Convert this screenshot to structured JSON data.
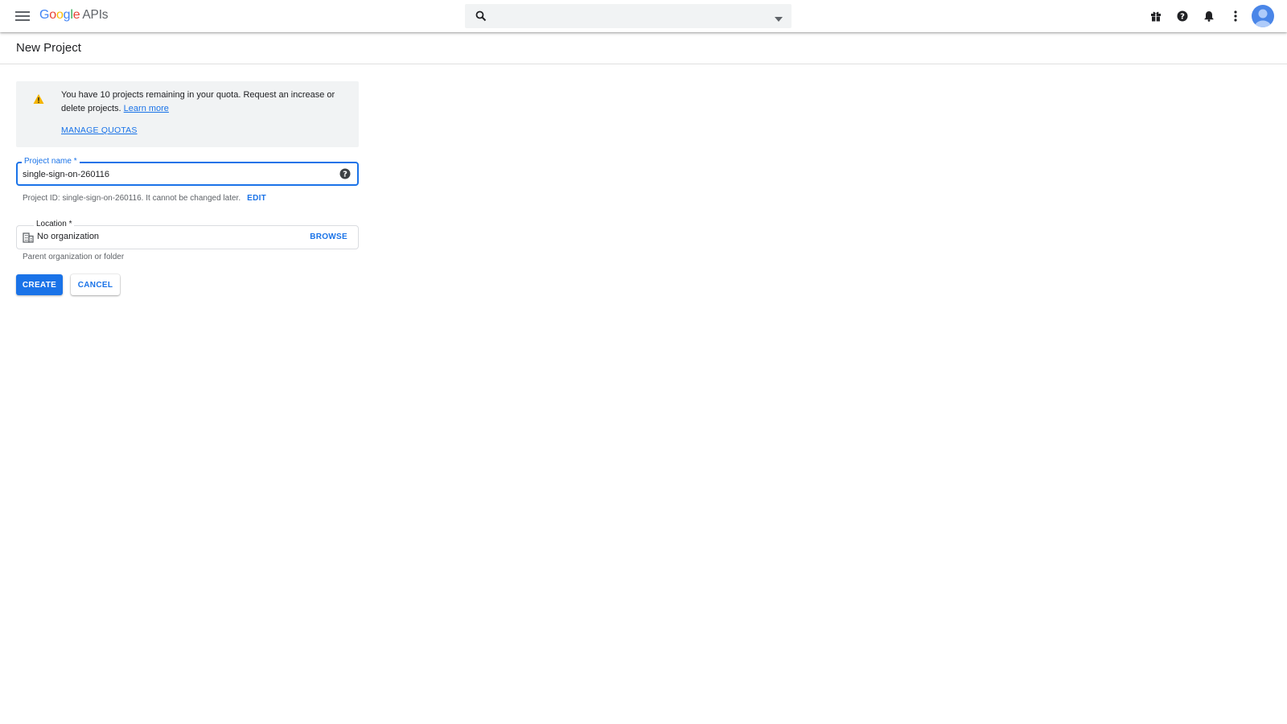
{
  "header": {
    "logo_letters": [
      "G",
      "o",
      "o",
      "g",
      "l",
      "e"
    ],
    "logo_colors": [
      "#4285F4",
      "#EA4335",
      "#FBBC05",
      "#4285F4",
      "#34A853",
      "#EA4335"
    ],
    "logo_suffix": "APIs",
    "search_value": "",
    "icons": [
      "menu-icon",
      "search-icon",
      "dropdown-arrow-icon",
      "gift-icon",
      "help-icon",
      "notifications-bell-icon",
      "more-vert-icon",
      "account-avatar"
    ]
  },
  "page": {
    "title": "New Project"
  },
  "quota_notice": {
    "message": "You have 10 projects remaining in your quota. Request an increase or delete projects.",
    "learn_more": "Learn more",
    "manage_quotas": "MANAGE QUOTAS",
    "icon": "warning-icon",
    "icon_color": "#F4B400"
  },
  "project_name": {
    "label": "Project name *",
    "value": "single-sign-on-260116"
  },
  "project_id": {
    "text": "Project ID: single-sign-on-260116. It cannot be changed later.",
    "edit_label": "EDIT"
  },
  "location": {
    "label": "Location *",
    "value": "No organization",
    "browse_label": "BROWSE",
    "hint": "Parent organization or folder",
    "icon": "organization-building-icon"
  },
  "actions": {
    "create_label": "CREATE",
    "cancel_label": "CANCEL"
  },
  "colors": {
    "accent": "#1a73e8",
    "notice_bg": "#f1f3f4"
  }
}
